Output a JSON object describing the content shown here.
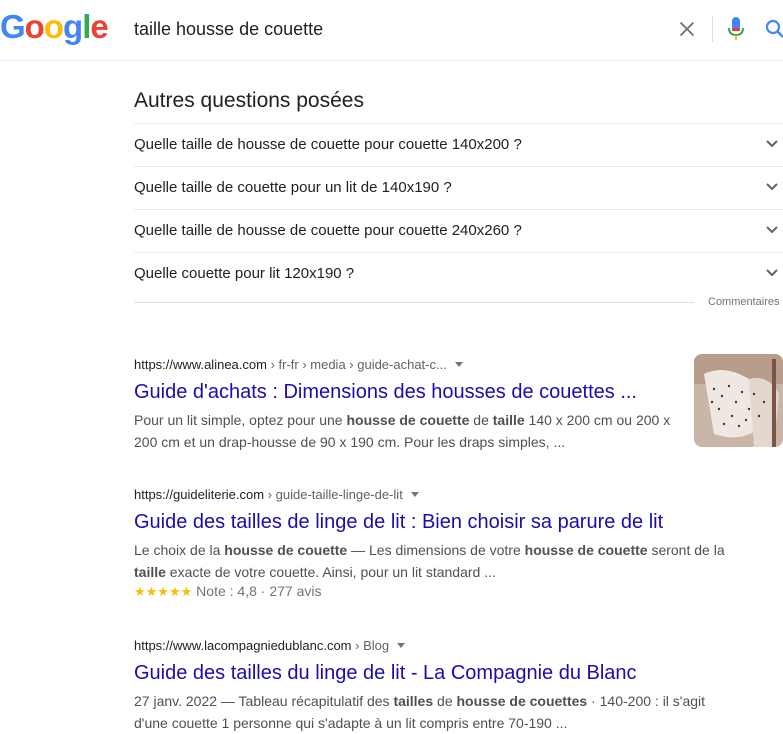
{
  "header": {
    "logo_letters": [
      "G",
      "o",
      "o",
      "g",
      "l",
      "e"
    ],
    "logo_colors": [
      "#4285F4",
      "#EA4335",
      "#FBBC05",
      "#4285F4",
      "#34A853",
      "#EA4335"
    ],
    "query": "taille housse de couette"
  },
  "paa": {
    "title": "Autres questions posées",
    "questions": [
      "Quelle taille de housse de couette pour couette 140x200 ?",
      "Quelle taille de couette pour un lit de 140x190 ?",
      "Quelle taille de housse de couette pour couette 240x260 ?",
      "Quelle couette pour lit 120x190 ?"
    ],
    "feedback": "Commentaires"
  },
  "results": [
    {
      "domain": "https://www.alinea.com",
      "path": " › fr-fr › media › guide-achat-c...",
      "title": "Guide d'achats : Dimensions des housses de couettes ...",
      "snippet": [
        {
          "t": "Pour un lit simple, optez pour une ",
          "b": false
        },
        {
          "t": "housse de couette",
          "b": true
        },
        {
          "t": " de ",
          "b": false
        },
        {
          "t": "taille",
          "b": true
        },
        {
          "t": " 140 x 200 cm ou 200 x 200 cm et un drap-housse de 90 x 190 cm. Pour les draps simples, ...",
          "b": false
        }
      ]
    },
    {
      "domain": "https://guideliterie.com",
      "path": " › guide-taille-linge-de-lit",
      "title": "Guide des tailles de linge de lit : Bien choisir sa parure de lit",
      "snippet": [
        {
          "t": "Le choix de la ",
          "b": false
        },
        {
          "t": "housse de couette",
          "b": true
        },
        {
          "t": " — Les dimensions de votre ",
          "b": false
        },
        {
          "t": "housse de couette",
          "b": true
        },
        {
          "t": " seront de la ",
          "b": false
        },
        {
          "t": "taille",
          "b": true
        },
        {
          "t": " exacte de votre couette. Ainsi, pour un lit standard ...",
          "b": false
        }
      ],
      "stars": "★★★★★",
      "rating_text": "Note : 4,8 · 277 avis"
    },
    {
      "domain": "https://www.lacompagniedublanc.com",
      "path": " › Blog",
      "title": "Guide des tailles du linge de lit - La Compagnie du Blanc",
      "snippet": [
        {
          "t": "27 janv. 2022 — Tableau récapitulatif des ",
          "b": false
        },
        {
          "t": "tailles",
          "b": true
        },
        {
          "t": " de ",
          "b": false
        },
        {
          "t": "housse de couettes",
          "b": true
        },
        {
          "t": " · 140-200 : il s'agit d'une couette 1 personne qui s'adapte à un lit compris entre 70-190 ...",
          "b": false
        }
      ]
    }
  ]
}
